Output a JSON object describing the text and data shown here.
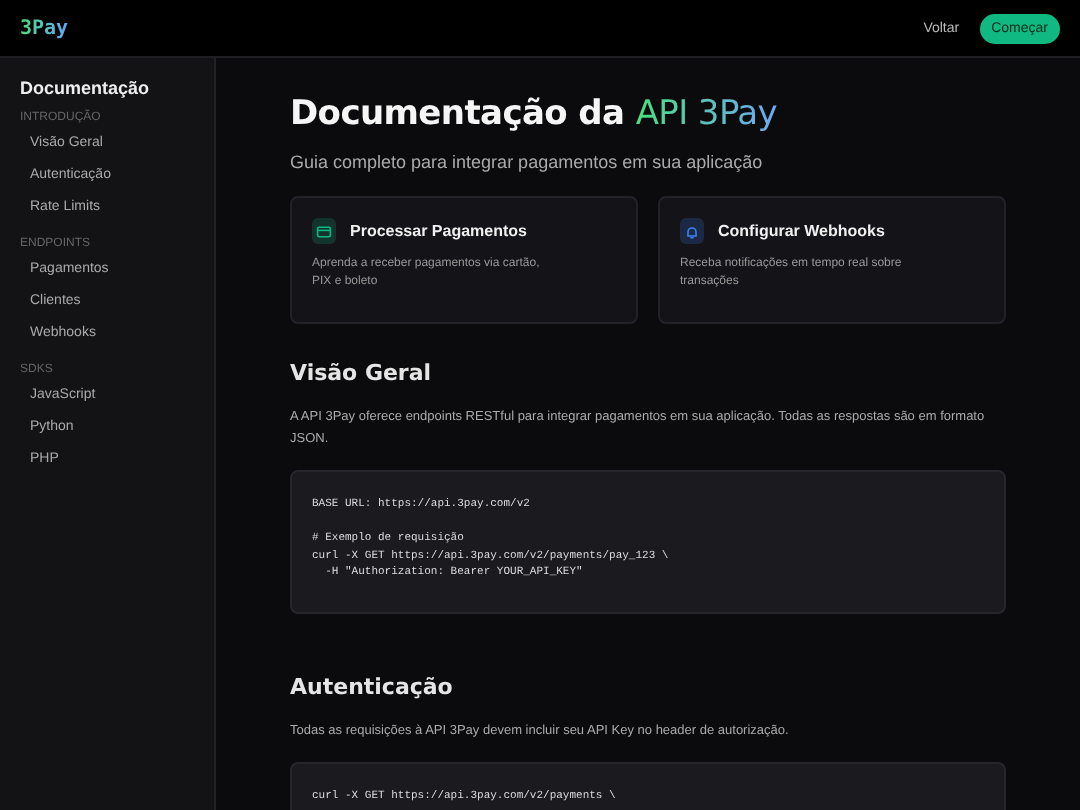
{
  "header": {
    "logo": "3Pay",
    "links": [
      {
        "label": "Voltar",
        "kind": "link"
      },
      {
        "label": "Começar",
        "kind": "primary"
      }
    ]
  },
  "sidebar": {
    "title": "Documentação",
    "sections": [
      {
        "heading": "INTRODUÇÃO",
        "items": [
          "Visão Geral",
          "Autenticação",
          "Rate Limits"
        ]
      },
      {
        "heading": "ENDPOINTS",
        "items": [
          "Pagamentos",
          "Clientes",
          "Webhooks"
        ]
      },
      {
        "heading": "SDKS",
        "items": [
          "JavaScript",
          "Python",
          "PHP"
        ]
      }
    ]
  },
  "main": {
    "title": "Documentação da ",
    "title_highlight": "API 3Pay",
    "subtitle": "Guia completo para integrar pagamentos em sua aplicação",
    "cards": [
      {
        "title": "Processar Pagamentos",
        "text": "Aprenda a receber pagamentos via cartão, PIX e boleto",
        "kind": "card",
        "color": "#10b981"
      },
      {
        "title": "Configurar Webhooks",
        "text": "Receba notificações em tempo real sobre transações",
        "kind": "bell",
        "color": "#3b82f6"
      }
    ],
    "sections": [
      {
        "heading": "Visão Geral",
        "text": "A API 3Pay oferece endpoints RESTful para integrar pagamentos em sua aplicação. Todas as respostas são em formato JSON.",
        "code": "BASE URL: https://api.3pay.com/v2\n\n# Exemplo de requisição\ncurl -X GET https://api.3pay.com/v2/payments/pay_123 \\\n  -H \"Authorization: Bearer YOUR_API_KEY\""
      },
      {
        "heading": "Autenticação",
        "text": "Todas as requisições à API 3Pay devem incluir seu API Key no header de autorização.",
        "code": "curl -X GET https://api.3pay.com/v2/payments \\"
      }
    ]
  }
}
